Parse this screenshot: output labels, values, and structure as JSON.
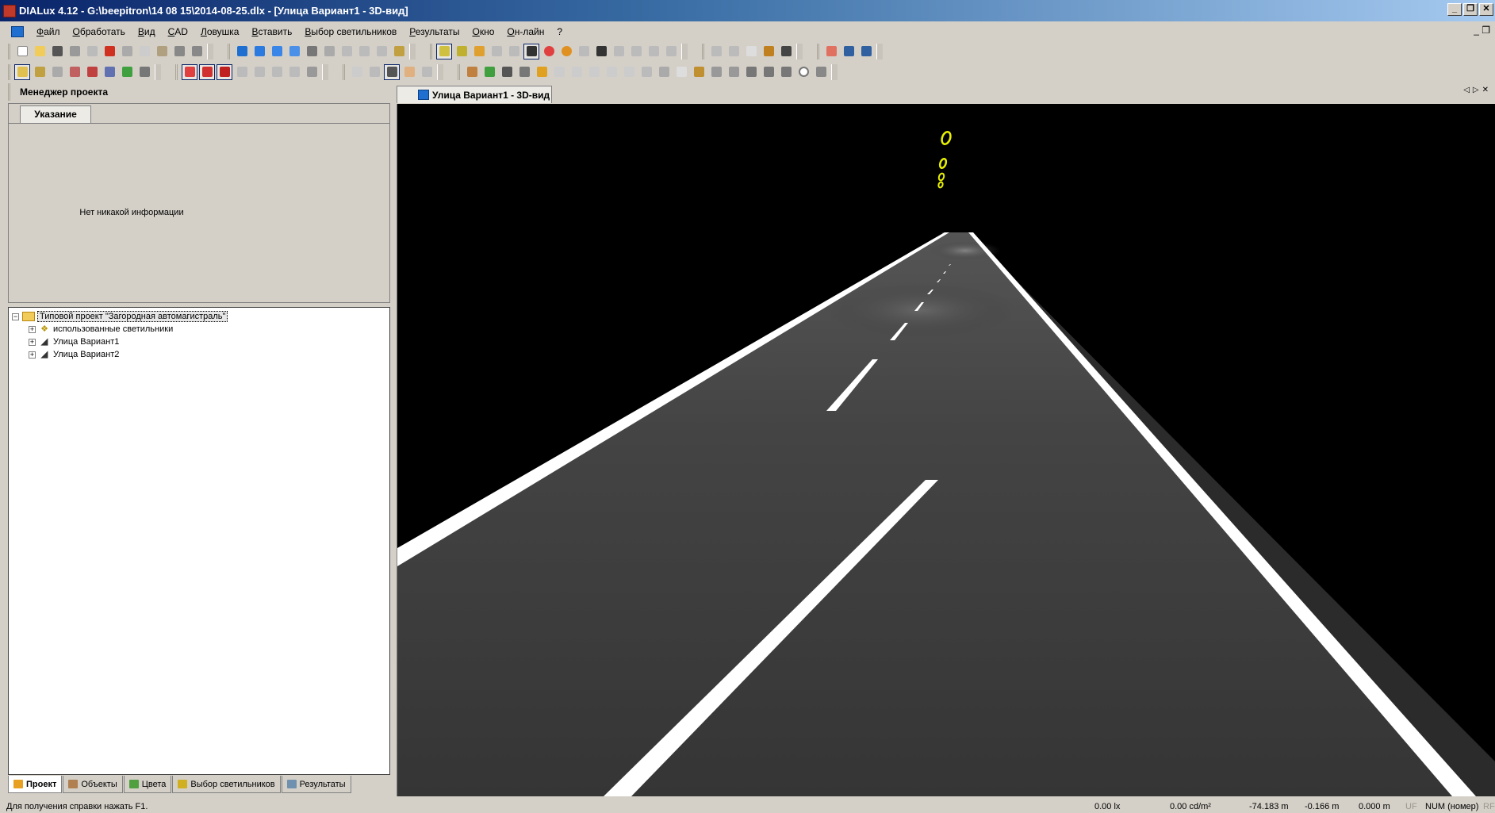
{
  "window": {
    "title": "DIALux 4.12 - G:\\beepitron\\14 08 15\\2014-08-25.dlx - [Улица Вариант1 - 3D-вид]",
    "controls": [
      "_",
      "❐",
      "✕"
    ]
  },
  "menu": {
    "items": [
      "Файл",
      "Обработать",
      "Вид",
      "CAD",
      "Ловушка",
      "Вставить",
      "Выбор светильников",
      "Результаты",
      "Окно",
      "Он-лайн",
      "?"
    ],
    "mdi_controls": "_ ❐"
  },
  "project_manager": {
    "title": "Менеджер проекта",
    "hint_tab": "Указание",
    "hint_text": "Нет никакой информации"
  },
  "tree": {
    "root": "Типовой проект \"Загородная автомагистраль\"",
    "children": [
      "использованные светильники",
      "Улица Вариант1",
      "Улица Вариант2"
    ]
  },
  "bottom_tabs": [
    {
      "label": "Проект",
      "color": "#e8a020"
    },
    {
      "label": "Объекты",
      "color": "#b08050"
    },
    {
      "label": "Цвета",
      "color": "#50a040"
    },
    {
      "label": "Выбор светильников",
      "color": "#d0b020"
    },
    {
      "label": "Результаты",
      "color": "#7090b0"
    }
  ],
  "view": {
    "tab_label": "Улица Вариант1 - 3D-вид",
    "tab_scroll": "◁▷✕",
    "luminaire_color": "#e8f000"
  },
  "status": {
    "help": "Для получения справки нажать F1.",
    "illuminance": "0.00 lx",
    "luminance": "0.00 cd/m²",
    "x": "-74.183 m",
    "y": "-0.166 m",
    "z": "0.000 m",
    "uf": "UF",
    "num": "NUM (номер)",
    "rf": "RF"
  },
  "colors": {
    "accent": "#0a246a",
    "background": "#d4d0c8",
    "road": "#3a3a3a"
  }
}
